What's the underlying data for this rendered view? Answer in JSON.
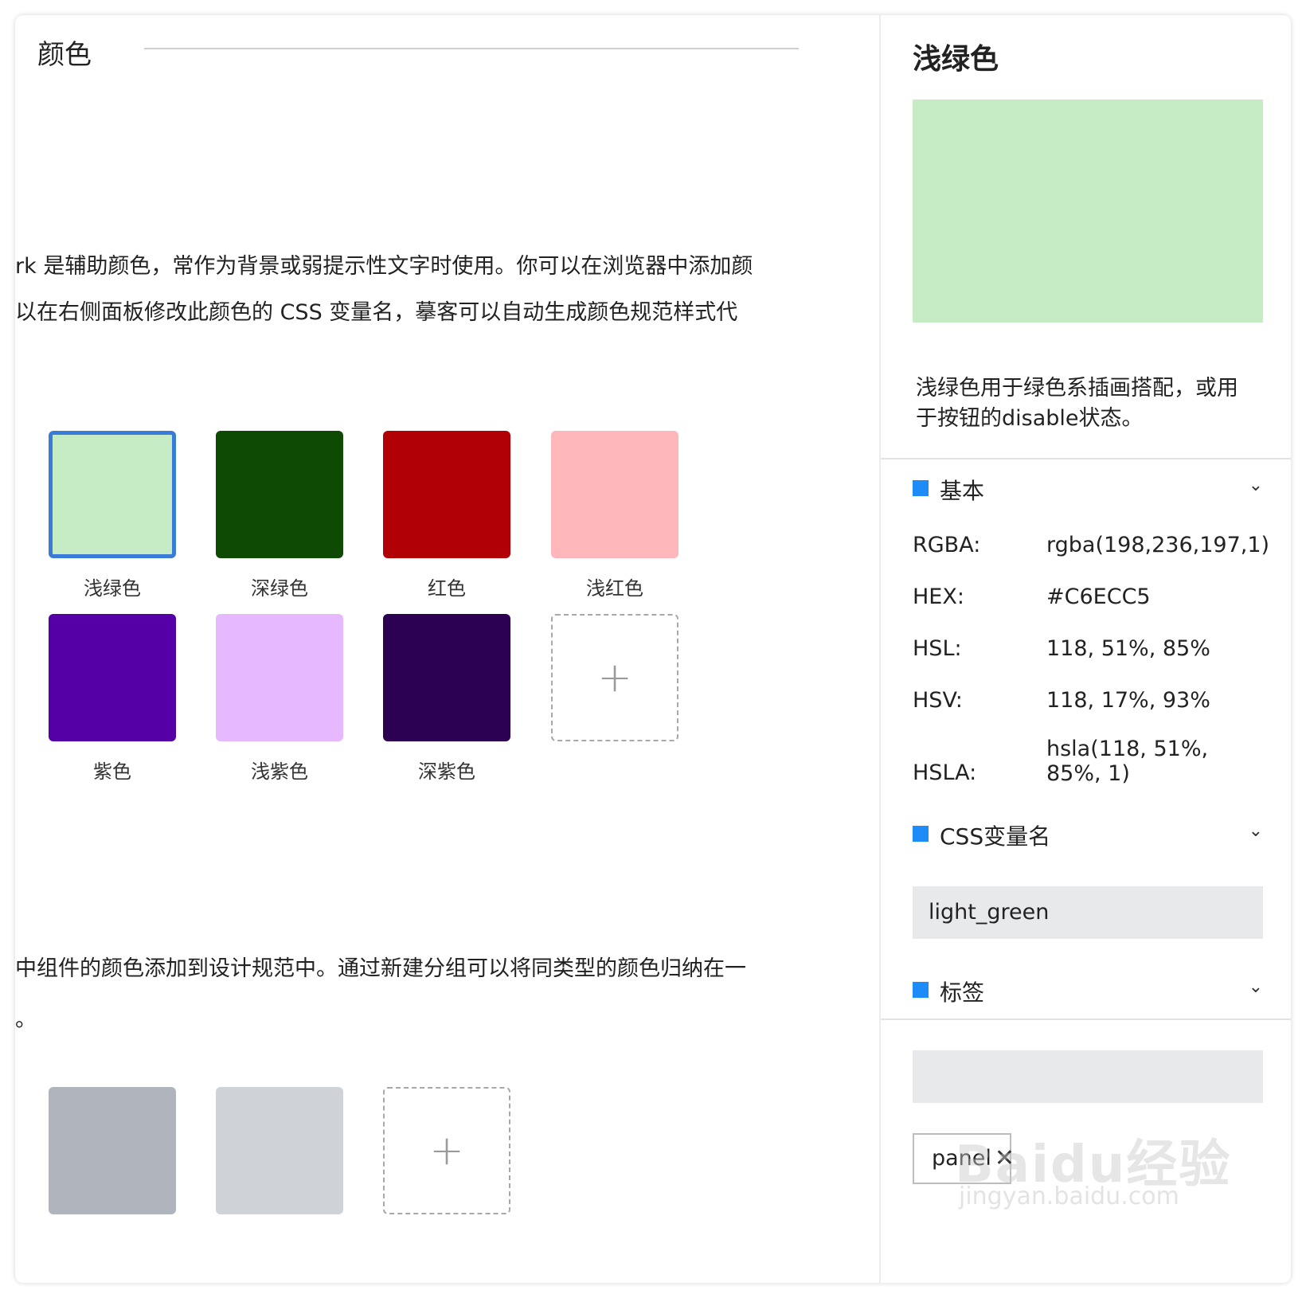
{
  "left": {
    "title": "颜色",
    "desc_lines": [
      "rk 是辅助颜色，常作为背景或弱提示性文字时使用。你可以在浏览器中添加颜",
      "以在右侧面板修改此颜色的 CSS 变量名，摹客可以自动生成颜色规范样式代",
      "中组件的颜色添加到设计规范中。通过新建分组可以将同类型的颜色归纳在一",
      "。"
    ],
    "swatches": [
      {
        "label": "浅绿色",
        "color": "#C6ECC5",
        "selected": true
      },
      {
        "label": "深绿色",
        "color": "#0E4A04"
      },
      {
        "label": "红色",
        "color": "#B20007"
      },
      {
        "label": "浅红色",
        "color": "#FDB7BA"
      },
      {
        "label": "紫色",
        "color": "#5400A6"
      },
      {
        "label": "浅紫色",
        "color": "#E6B8FF"
      },
      {
        "label": "深紫色",
        "color": "#2C0052"
      }
    ],
    "group2_swatches": [
      {
        "color": "#B0B5BD"
      },
      {
        "color": "#CFD3D8"
      }
    ],
    "add_symbol": "+"
  },
  "panel": {
    "title": "浅绿色",
    "preview_color": "#C6ECC5",
    "description": "浅绿色用于绿色系插画搭配，或用于按钮的disable状态。",
    "sections": {
      "basic": "基本",
      "css_var": "CSS变量名",
      "tags": "标签"
    },
    "chevron": "⌄",
    "rows": [
      {
        "key": "RGBA:",
        "value": "rgba(198,236,197,1)"
      },
      {
        "key": "HEX:",
        "value": "#C6ECC5"
      },
      {
        "key": "HSL:",
        "value": "118, 51%, 85%"
      },
      {
        "key": "HSV:",
        "value": "118, 17%, 93%"
      },
      {
        "key": "HSLA:",
        "value": "hsla(118, 51%, 85%, 1)"
      }
    ],
    "css_var_value": "light_green",
    "tag_input_value": "",
    "tag_chip": "panel",
    "tag_remove": "✕"
  },
  "watermark": {
    "logo": "Baidu经验",
    "url": "jingyan.baidu.com"
  },
  "colors": {
    "accent": "#1D8CF8",
    "selected_border": "#3B7BD8",
    "input_bg": "#E8E9EB"
  }
}
